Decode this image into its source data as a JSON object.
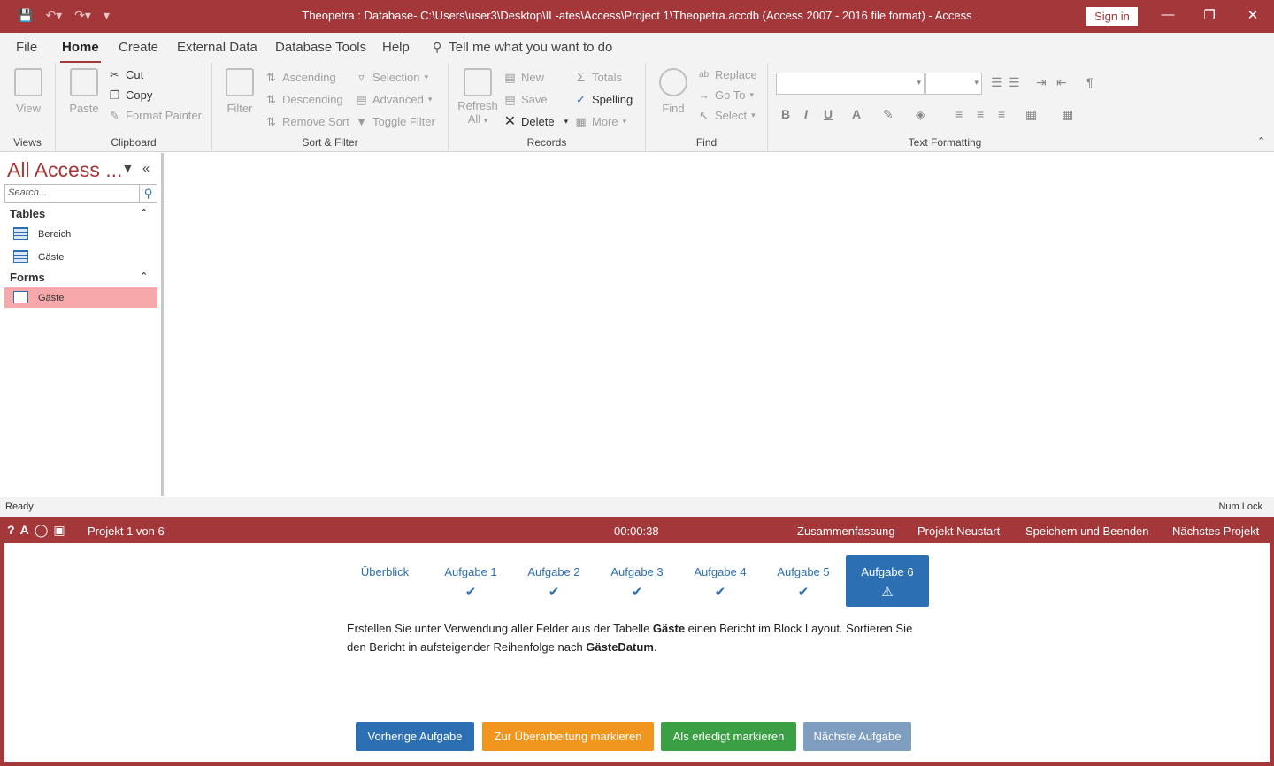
{
  "titlebar": {
    "title": "Theopetra : Database- C:\\Users\\user3\\Desktop\\IL-ates\\Access\\Project 1\\Theopetra.accdb (Access 2007 - 2016 file format)  -  Access",
    "sign_in": "Sign in"
  },
  "tabs": {
    "file": "File",
    "home": "Home",
    "create": "Create",
    "external_data": "External Data",
    "database_tools": "Database Tools",
    "help": "Help",
    "tell_me": "Tell me what you want to do"
  },
  "ribbon": {
    "views": {
      "view": "View",
      "label": "Views"
    },
    "clipboard": {
      "paste": "Paste",
      "cut": "Cut",
      "copy": "Copy",
      "format_painter": "Format Painter",
      "label": "Clipboard"
    },
    "sort_filter": {
      "filter": "Filter",
      "ascending": "Ascending",
      "descending": "Descending",
      "remove_sort": "Remove Sort",
      "selection": "Selection",
      "advanced": "Advanced",
      "toggle_filter": "Toggle Filter",
      "label": "Sort & Filter"
    },
    "records": {
      "refresh_all_1": "Refresh",
      "refresh_all_2": "All",
      "new": "New",
      "save": "Save",
      "delete": "Delete",
      "totals": "Totals",
      "spelling": "Spelling",
      "more": "More",
      "label": "Records"
    },
    "find": {
      "find": "Find",
      "replace": "Replace",
      "go_to": "Go To",
      "select": "Select",
      "label": "Find"
    },
    "text_formatting": {
      "label": "Text Formatting"
    }
  },
  "nav": {
    "header": "All Access ...",
    "search_placeholder": "Search...",
    "categories": [
      {
        "label": "Tables",
        "items": [
          "Bereich",
          "Gäste"
        ]
      },
      {
        "label": "Forms",
        "items": [
          "Gäste"
        ]
      }
    ]
  },
  "status": {
    "left": "Ready",
    "right": "Num Lock"
  },
  "task": {
    "project": "Projekt 1 von 6",
    "timer": "00:00:38",
    "links": [
      "Zusammenfassung",
      "Projekt Neustart",
      "Speichern und Beenden",
      "Nächstes Projekt"
    ],
    "steps": [
      "Überblick",
      "Aufgabe 1",
      "Aufgabe 2",
      "Aufgabe 3",
      "Aufgabe 4",
      "Aufgabe 5",
      "Aufgabe 6"
    ],
    "instruction": {
      "p1": "Erstellen Sie unter Verwendung aller Felder aus der Tabelle ",
      "b1": "Gäste",
      "p2": " einen Bericht im Block Layout. Sortieren Sie den Bericht in aufsteigender Reihenfolge nach ",
      "b2": "GästeDatum",
      "p3": "."
    },
    "buttons": {
      "prev": "Vorherige Aufgabe",
      "review": "Zur Überarbeitung markieren",
      "done": "Als erledigt markieren",
      "next": "Nächste Aufgabe"
    }
  },
  "colors": {
    "accent": "#a4373a",
    "selected_item": "#f6a8ab",
    "blue": "#2c6fb3",
    "orange": "#f0961e",
    "green": "#3aa043",
    "grayblue": "#7f9dbf"
  }
}
